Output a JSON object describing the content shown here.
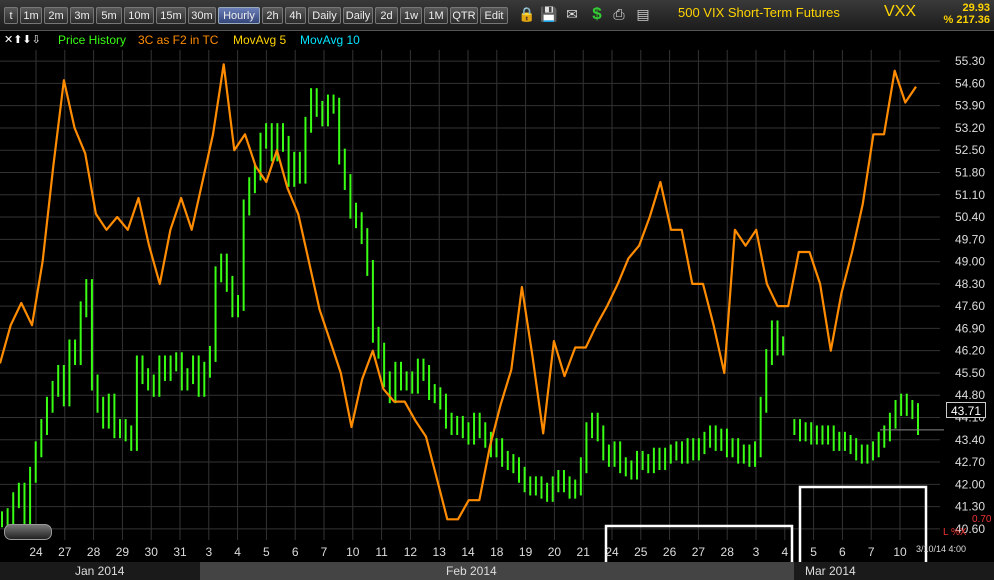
{
  "toolbar": {
    "buttons": [
      "t",
      "1m",
      "2m",
      "3m",
      "5m",
      "10m",
      "15m",
      "30m",
      "Hourly",
      "2h",
      "4h",
      "Daily",
      "Daily",
      "2d",
      "1w",
      "1M",
      "QTR",
      "Edit"
    ],
    "active_index": 8,
    "icons": [
      "lock-icon",
      "save-icon",
      "mail-icon",
      "dollar-icon",
      "print-icon",
      "card-icon"
    ]
  },
  "header": {
    "title": "500 VIX Short-Term Futures",
    "symbol": "VXX",
    "last": "29.93",
    "change": "% 217.36"
  },
  "legend": {
    "arrows": "✕⬆⬇⇩",
    "items": [
      "Price History",
      "3C as F2 in TC",
      "MovAvg 5",
      "MovAvg 10"
    ],
    "colors": [
      "#39ff14",
      "#ff8c00",
      "#ffd400",
      "#00e5ff"
    ]
  },
  "chart_data": {
    "type": "line",
    "y_ticks": [
      55.3,
      54.6,
      53.9,
      53.2,
      52.5,
      51.8,
      51.1,
      50.4,
      49.7,
      49.0,
      48.3,
      47.6,
      46.9,
      46.2,
      45.5,
      44.8,
      44.1,
      43.4,
      42.7,
      42.0,
      41.3,
      40.6
    ],
    "ylim": [
      40.25,
      55.65
    ],
    "x_ticks": [
      "24",
      "27",
      "28",
      "29",
      "30",
      "31",
      "3",
      "4",
      "5",
      "6",
      "7",
      "10",
      "11",
      "12",
      "13",
      "14",
      "18",
      "19",
      "20",
      "21",
      "24",
      "25",
      "26",
      "27",
      "28",
      "3",
      "4",
      "5",
      "6",
      "7",
      "10"
    ],
    "months": [
      "Jan 2014",
      "Feb 2014",
      "Mar 2014"
    ],
    "last_price": "43.71",
    "date_stamp": "3/10/14 4:00",
    "indicator_value": "0.70",
    "indicator_label": "L %X",
    "series": [
      {
        "name": "Price History",
        "color": "#39ff14",
        "values": [
          40.9,
          41.0,
          41.5,
          41.8,
          40.9,
          42.3,
          43.1,
          43.8,
          44.5,
          45.0,
          45.5,
          44.7,
          46.3,
          46.0,
          47.5,
          48.2,
          45.2,
          44.5,
          44.0,
          44.6,
          43.7,
          43.8,
          43.6,
          43.3,
          45.8,
          45.4,
          45.2,
          45.0,
          45.8,
          45.5,
          45.8,
          45.9,
          45.2,
          45.4,
          45.8,
          45.0,
          45.6,
          46.1,
          48.6,
          49.0,
          48.3,
          47.5,
          47.7,
          50.7,
          51.4,
          51.8,
          52.8,
          53.1,
          52.4,
          53.1,
          52.7,
          51.6,
          52.2,
          51.7,
          53.3,
          54.2,
          53.8,
          53.5,
          54.0,
          53.9,
          52.3,
          51.5,
          50.6,
          50.3,
          49.8,
          48.8,
          46.7,
          46.2,
          45.3,
          44.8,
          45.6,
          45.2,
          45.3,
          45.1,
          45.7,
          45.5,
          44.9,
          44.8,
          44.6,
          44.0,
          43.8,
          43.9,
          43.7,
          43.5,
          44.0,
          43.7,
          43.4,
          43.1,
          43.2,
          42.8,
          42.7,
          42.6,
          42.3,
          42.0,
          41.9,
          42.0,
          41.8,
          41.7,
          42.0,
          42.2,
          42.0,
          41.8,
          41.9,
          42.6,
          43.7,
          44.0,
          43.6,
          43.0,
          42.8,
          43.1,
          42.6,
          42.5,
          42.4,
          42.8,
          42.7,
          42.6,
          42.9,
          42.7,
          42.9,
          43.0,
          43.1,
          42.9,
          43.2,
          43.0,
          43.2,
          43.4,
          43.6,
          43.3,
          43.5,
          43.1,
          43.2,
          42.9,
          43.0,
          42.8,
          43.1,
          44.5,
          46.0,
          46.9,
          46.3,
          46.4,
          null,
          43.8,
          43.6,
          43.7,
          43.5,
          43.6,
          43.5,
          43.6,
          43.3,
          43.4,
          43.3,
          43.2,
          43.0,
          42.9,
          43.0,
          43.1,
          43.4,
          43.6,
          44.0,
          44.4,
          44.6,
          44.4,
          44.3,
          43.8
        ]
      },
      {
        "name": "3C as F2 in TC",
        "color": "#ff8c00",
        "values": [
          45.8,
          47.0,
          47.7,
          47.0,
          49.0,
          52.0,
          54.7,
          53.2,
          52.4,
          50.5,
          50.0,
          50.4,
          50.0,
          51.0,
          49.5,
          48.3,
          50.0,
          51.0,
          50.0,
          51.5,
          53.0,
          55.2,
          52.5,
          53.0,
          52.0,
          51.5,
          52.5,
          51.3,
          50.5,
          49.0,
          47.5,
          46.5,
          45.5,
          43.8,
          45.3,
          46.2,
          45.0,
          44.6,
          44.6,
          44.0,
          43.5,
          42.2,
          40.9,
          40.9,
          41.5,
          41.5,
          43.2,
          44.5,
          45.6,
          48.2,
          46.0,
          43.6,
          46.5,
          45.4,
          46.3,
          46.3,
          47.0,
          47.6,
          48.3,
          49.1,
          49.5,
          50.4,
          51.5,
          50.0,
          50.0,
          48.3,
          48.3,
          47.0,
          45.5,
          50.0,
          49.5,
          50.0,
          48.3,
          47.6,
          47.6,
          49.3,
          49.3,
          48.3,
          46.2,
          48.0,
          49.3,
          50.8,
          53.0,
          53.0,
          55.0,
          54.0,
          54.5
        ]
      }
    ]
  }
}
